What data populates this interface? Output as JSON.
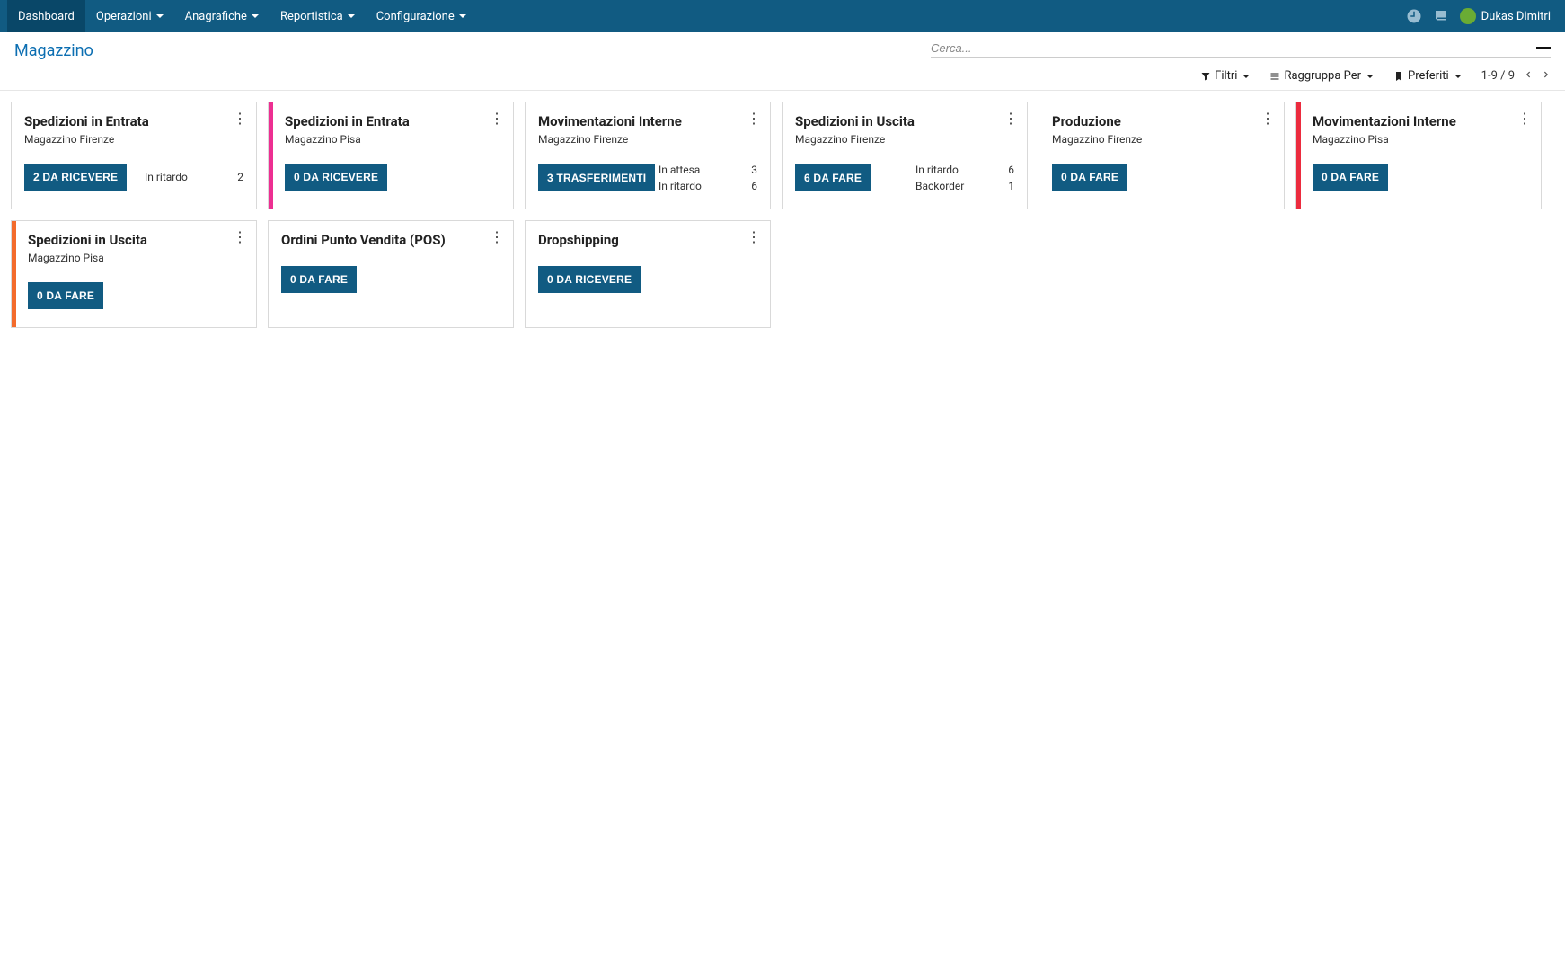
{
  "nav": {
    "items": [
      {
        "label": "Dashboard",
        "active": true,
        "dropdown": false
      },
      {
        "label": "Operazioni",
        "active": false,
        "dropdown": true
      },
      {
        "label": "Anagrafiche",
        "active": false,
        "dropdown": true
      },
      {
        "label": "Reportistica",
        "active": false,
        "dropdown": true
      },
      {
        "label": "Configurazione",
        "active": false,
        "dropdown": true
      }
    ],
    "user": "Dukas Dimitri"
  },
  "control": {
    "title": "Magazzino",
    "search_placeholder": "Cerca...",
    "filters_label": "Filtri",
    "group_label": "Raggruppa Per",
    "favorites_label": "Preferiti",
    "pager_text": "1-9 / 9"
  },
  "cards": [
    {
      "title": "Spedizioni in Entrata",
      "subtitle": "Magazzino Firenze",
      "button": "2 DA RICEVERE",
      "accent": null,
      "status": [
        {
          "label": "In ritardo",
          "value": "2"
        }
      ]
    },
    {
      "title": "Spedizioni in Entrata",
      "subtitle": "Magazzino Pisa",
      "button": "0 DA RICEVERE",
      "accent": "pink",
      "status": []
    },
    {
      "title": "Movimentazioni Interne",
      "subtitle": "Magazzino Firenze",
      "button": "3 TRASFERIMENTI",
      "accent": null,
      "status": [
        {
          "label": "In attesa",
          "value": "3"
        },
        {
          "label": "In ritardo",
          "value": "6"
        }
      ]
    },
    {
      "title": "Spedizioni in Uscita",
      "subtitle": "Magazzino Firenze",
      "button": "6 DA FARE",
      "accent": null,
      "status": [
        {
          "label": "In ritardo",
          "value": "6"
        },
        {
          "label": "Backorder",
          "value": "1"
        }
      ]
    },
    {
      "title": "Produzione",
      "subtitle": "Magazzino Firenze",
      "button": "0 DA FARE",
      "accent": null,
      "status": []
    },
    {
      "title": "Movimentazioni Interne",
      "subtitle": "Magazzino Pisa",
      "button": "0 DA FARE",
      "accent": "red",
      "status": []
    },
    {
      "title": "Spedizioni in Uscita",
      "subtitle": "Magazzino Pisa",
      "button": "0 DA FARE",
      "accent": "orange",
      "status": []
    },
    {
      "title": "Ordini Punto Vendita (POS)",
      "subtitle": "",
      "button": "0 DA FARE",
      "accent": null,
      "status": []
    },
    {
      "title": "Dropshipping",
      "subtitle": "",
      "button": "0 DA RICEVERE",
      "accent": null,
      "status": []
    }
  ]
}
